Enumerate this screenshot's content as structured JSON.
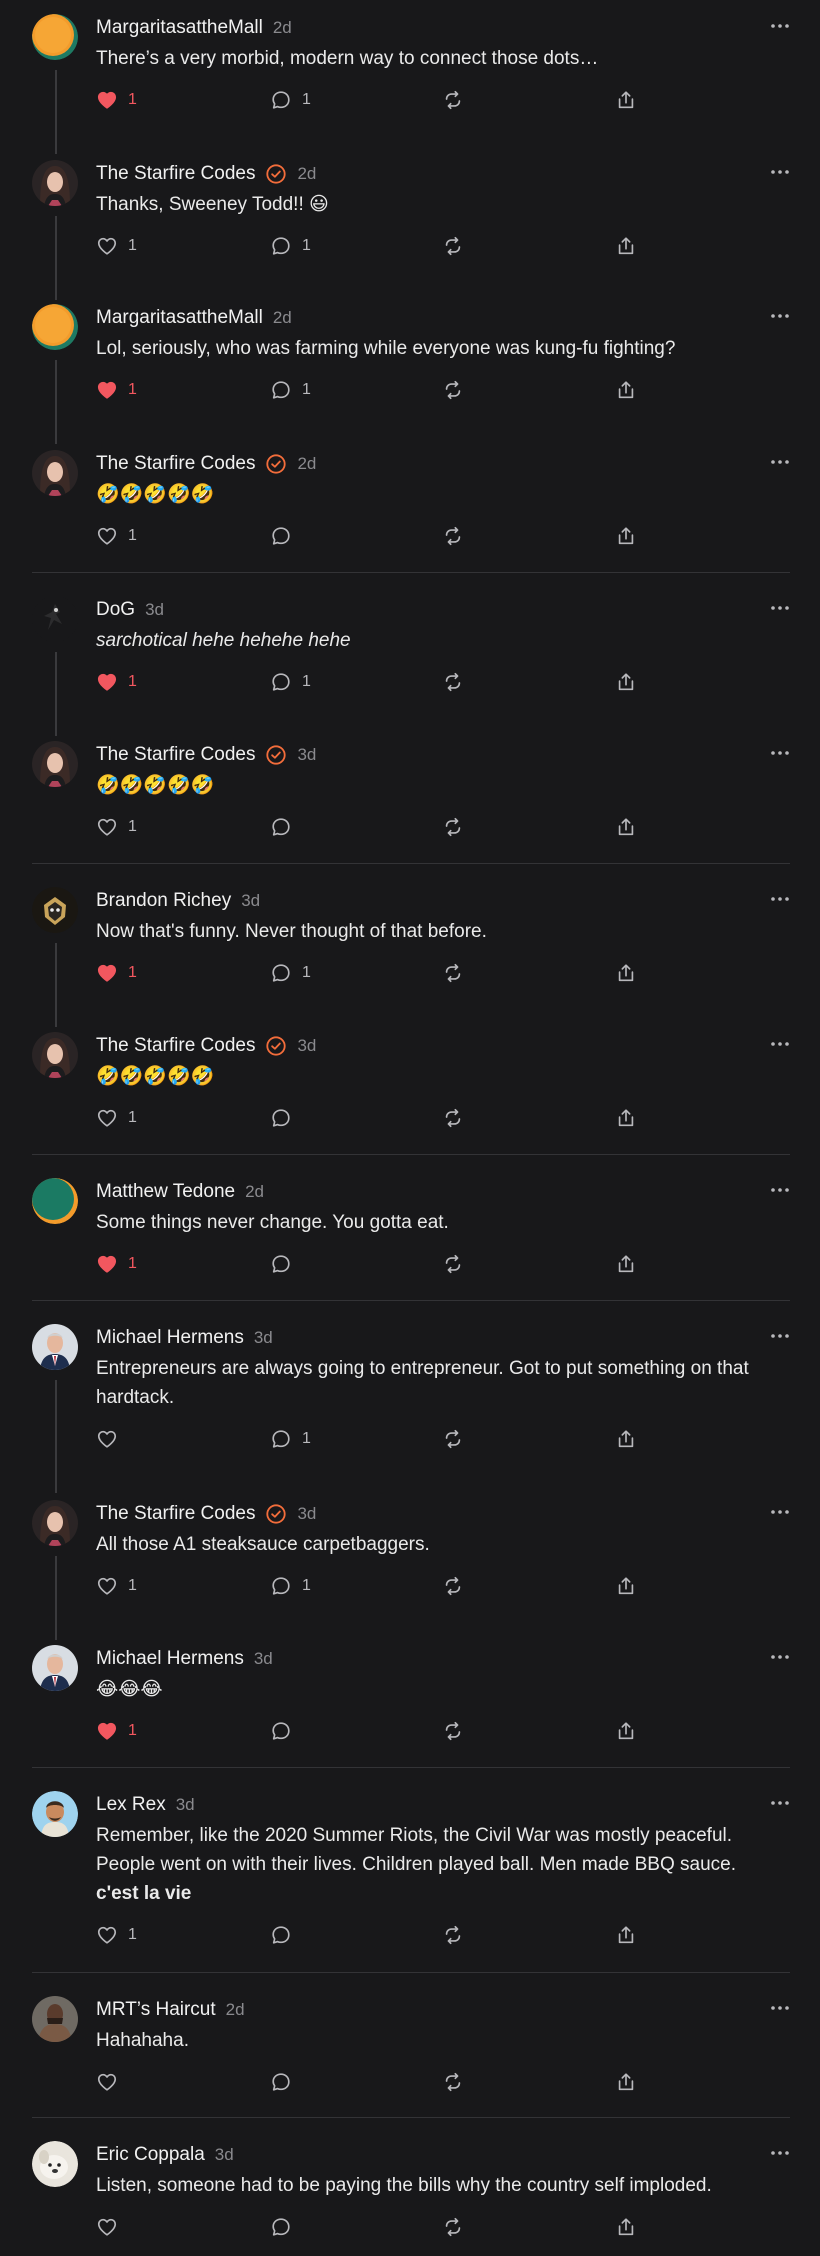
{
  "colors": {
    "background": "#18181a",
    "liked": "#f2575f",
    "verified": "#f36d3b",
    "muted": "#8a8a8e"
  },
  "posts": [
    {
      "author": "MargaritasattheMall",
      "time": "2d",
      "verified": false,
      "text": "There’s a very morbid, modern way to connect those dots…",
      "likes": "1",
      "liked": true,
      "replies": "1",
      "avatar": "orange-green-circle-avatar"
    },
    {
      "author": "The Starfire Codes",
      "time": "2d",
      "verified": true,
      "text": "Thanks, Sweeney Todd!! 😃",
      "likes": "1",
      "liked": false,
      "replies": "1",
      "avatar": "woman-portrait-avatar"
    },
    {
      "author": "MargaritasattheMall",
      "time": "2d",
      "verified": false,
      "text": "Lol, seriously, who was farming while everyone was kung-fu fighting?",
      "likes": "1",
      "liked": true,
      "replies": "1",
      "avatar": "orange-green-circle-avatar"
    },
    {
      "author": "The Starfire Codes",
      "time": "2d",
      "verified": true,
      "text": "🤣🤣🤣🤣🤣",
      "likes": "1",
      "liked": false,
      "replies": "",
      "avatar": "woman-portrait-avatar"
    },
    {
      "author": "DoG",
      "time": "3d",
      "verified": false,
      "text": "sarchotical hehe hehehe hehe",
      "likes": "1",
      "liked": true,
      "replies": "1",
      "avatar": "dark-figure-avatar"
    },
    {
      "author": "The Starfire Codes",
      "time": "3d",
      "verified": true,
      "text": "🤣🤣🤣🤣🤣",
      "likes": "1",
      "liked": false,
      "replies": "",
      "avatar": "woman-portrait-avatar"
    },
    {
      "author": "Brandon Richey",
      "time": "3d",
      "verified": false,
      "text": "Now that's funny. Never thought of that before.",
      "likes": "1",
      "liked": true,
      "replies": "1",
      "avatar": "gorilla-logo-avatar"
    },
    {
      "author": "The Starfire Codes",
      "time": "3d",
      "verified": true,
      "text": "🤣🤣🤣🤣🤣",
      "likes": "1",
      "liked": false,
      "replies": "",
      "avatar": "woman-portrait-avatar"
    },
    {
      "author": "Matthew Tedone",
      "time": "2d",
      "verified": false,
      "text": "Some things never change. You gotta eat.",
      "likes": "1",
      "liked": true,
      "replies": "",
      "avatar": "green-orange-circle-avatar"
    },
    {
      "author": "Michael Hermens",
      "time": "3d",
      "verified": false,
      "text": "Entrepreneurs are always going to entrepreneur. Got to put something on that hardtack.",
      "likes": "",
      "liked": false,
      "replies": "1",
      "avatar": "man-suit-avatar"
    },
    {
      "author": "The Starfire Codes",
      "time": "3d",
      "verified": true,
      "text": "All those A1 steaksauce carpetbaggers.",
      "likes": "1",
      "liked": false,
      "replies": "1",
      "avatar": "woman-portrait-avatar"
    },
    {
      "author": "Michael Hermens",
      "time": "3d",
      "verified": false,
      "text": "😂😂😂",
      "likes": "1",
      "liked": true,
      "replies": "",
      "avatar": "man-suit-avatar"
    },
    {
      "author": "Lex Rex",
      "time": "3d",
      "verified": false,
      "text": "Remember, like the 2020 Summer Riots, the Civil War was mostly peaceful. People went on with their lives. Children played ball. Men made BBQ sauce.",
      "text_bold": "c'est la vie",
      "likes": "1",
      "liked": false,
      "replies": "",
      "avatar": "cartoon-man-avatar"
    },
    {
      "author": "MRT’s Haircut",
      "time": "2d",
      "verified": false,
      "text": "Hahahaha.",
      "likes": "",
      "liked": false,
      "replies": "",
      "avatar": "portrait-avatar"
    },
    {
      "author": "Eric Coppala",
      "time": "3d",
      "verified": false,
      "text": "Listen, someone had to be paying the bills why the country self imploded.",
      "likes": "",
      "liked": false,
      "replies": "",
      "avatar": "white-dog-avatar"
    }
  ]
}
